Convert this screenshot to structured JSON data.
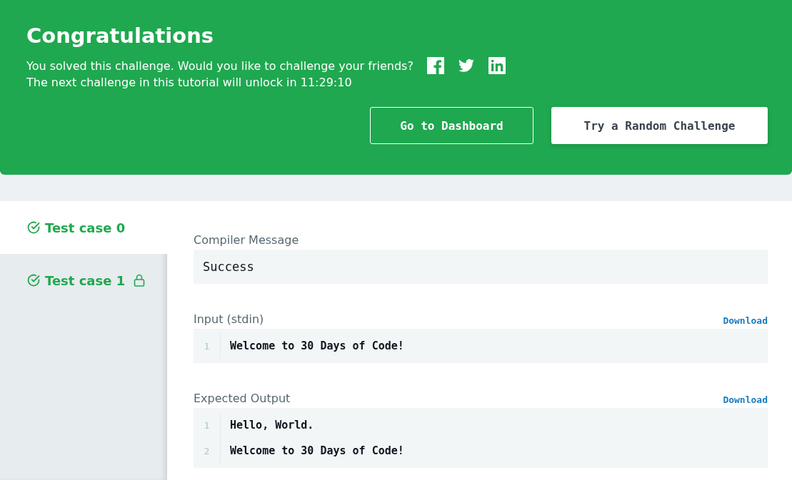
{
  "banner": {
    "title": "Congratulations",
    "message": "You solved this challenge. Would you like to challenge your friends?",
    "unlock": "The next challenge in this tutorial will unlock in 11:29:10",
    "share": [
      {
        "kind": "facebook"
      },
      {
        "kind": "twitter"
      },
      {
        "kind": "linkedin"
      }
    ],
    "buttons": [
      {
        "label": "Go to Dashboard",
        "kind": "outline"
      },
      {
        "label": "Try a Random Challenge",
        "kind": "solid"
      }
    ]
  },
  "test_cases": [
    {
      "label": "Test case 0",
      "selected": true,
      "passed": true,
      "locked": false
    },
    {
      "label": "Test case 1",
      "selected": false,
      "passed": true,
      "locked": true
    }
  ],
  "sections": [
    {
      "kind": "message",
      "label": "Compiler Message",
      "text": "Success"
    },
    {
      "kind": "code",
      "label": "Input (stdin)",
      "download": "Download",
      "lines": [
        {
          "number": "1",
          "text": "Welcome to 30 Days of Code!"
        }
      ]
    },
    {
      "kind": "code",
      "label": "Expected Output",
      "download": "Download",
      "lines": [
        {
          "number": "1",
          "text": "Hello, World."
        },
        {
          "number": "2",
          "text": "Welcome to 30 Days of Code!"
        }
      ]
    }
  ]
}
